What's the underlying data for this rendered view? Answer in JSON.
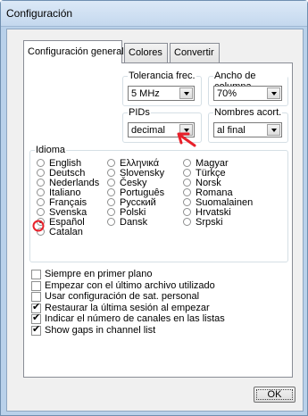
{
  "window": {
    "title": "Configuración"
  },
  "tabs": [
    {
      "label": "Configuración general",
      "active": true
    },
    {
      "label": "Colores",
      "active": false
    },
    {
      "label": "Convertir",
      "active": false
    }
  ],
  "groups": {
    "tolerancia": {
      "label": "Tolerancia frec.",
      "value": "5 MHz"
    },
    "ancho": {
      "label": "Ancho de columna",
      "value": "70%"
    },
    "pids": {
      "label": "PIDs",
      "value": "decimal"
    },
    "nombres": {
      "label": "Nombres acort.",
      "value": "al final"
    }
  },
  "idioma": {
    "label": "Idioma",
    "selected": "Español",
    "options": [
      "English",
      "Deutsch",
      "Nederlands",
      "Italiano",
      "Français",
      "Svenska",
      "Español",
      "Catalan",
      "Ελληνικά",
      "Slovensky",
      "Česky",
      "Português",
      "Русский",
      "Polski",
      "Dansk",
      "Magyar",
      "Türkçe",
      "Norsk",
      "Romana",
      "Suomalainen",
      "Hrvatski",
      "Srpski"
    ]
  },
  "checkboxes": [
    {
      "label": "Siempre en primer plano",
      "checked": false
    },
    {
      "label": "Empezar con el último archivo utilizado",
      "checked": false
    },
    {
      "label": "Usar configuración de sat. personal",
      "checked": false
    },
    {
      "label": "Restaurar la última sesión al empezar",
      "checked": true
    },
    {
      "label": "Indicar el número de canales en las listas",
      "checked": true
    },
    {
      "label": "Show gaps in channel list",
      "checked": true
    }
  ],
  "buttons": {
    "ok": "OK"
  },
  "colors": {
    "annotation": "#e8202a",
    "window_frame": "#b9d1ea"
  }
}
